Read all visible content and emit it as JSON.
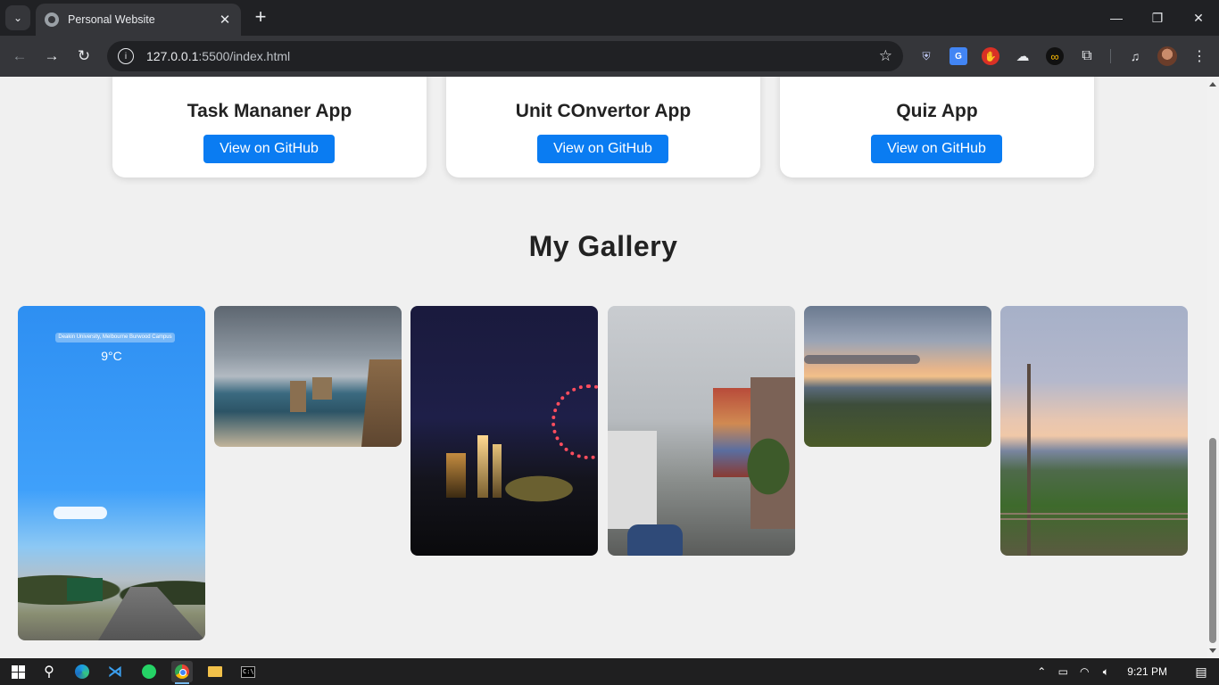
{
  "browser": {
    "tab_title": "Personal Website",
    "url_host": "127.0.0.1",
    "url_rest": ":5500/index.html",
    "icons": {
      "tab_search": "chevron-down-icon",
      "new_tab": "plus-icon",
      "minimize": "minimize-icon",
      "restore": "restore-icon",
      "close": "close-icon",
      "back": "arrow-left-icon",
      "forward": "arrow-right-icon",
      "reload": "reload-icon",
      "site_info": "info-icon",
      "bookmark": "star-icon",
      "extensions": "puzzle-icon",
      "menu": "kebab-menu-icon"
    }
  },
  "projects": [
    {
      "title": "Task Mananer App",
      "button": "View on GitHub"
    },
    {
      "title": "Unit COnvertor App",
      "button": "View on GitHub"
    },
    {
      "title": "Quiz App",
      "button": "View on GitHub"
    }
  ],
  "gallery": {
    "title": "My Gallery",
    "photo1_location": "Deakin University, Melbourne Burwood Campus",
    "photo1_temp": "9°C"
  },
  "taskbar": {
    "time": "9:21 PM"
  },
  "colors": {
    "accent_button": "#0a7cf2",
    "page_bg": "#f0f0f0",
    "chrome_dark": "#202124",
    "toolbar": "#35363a"
  }
}
